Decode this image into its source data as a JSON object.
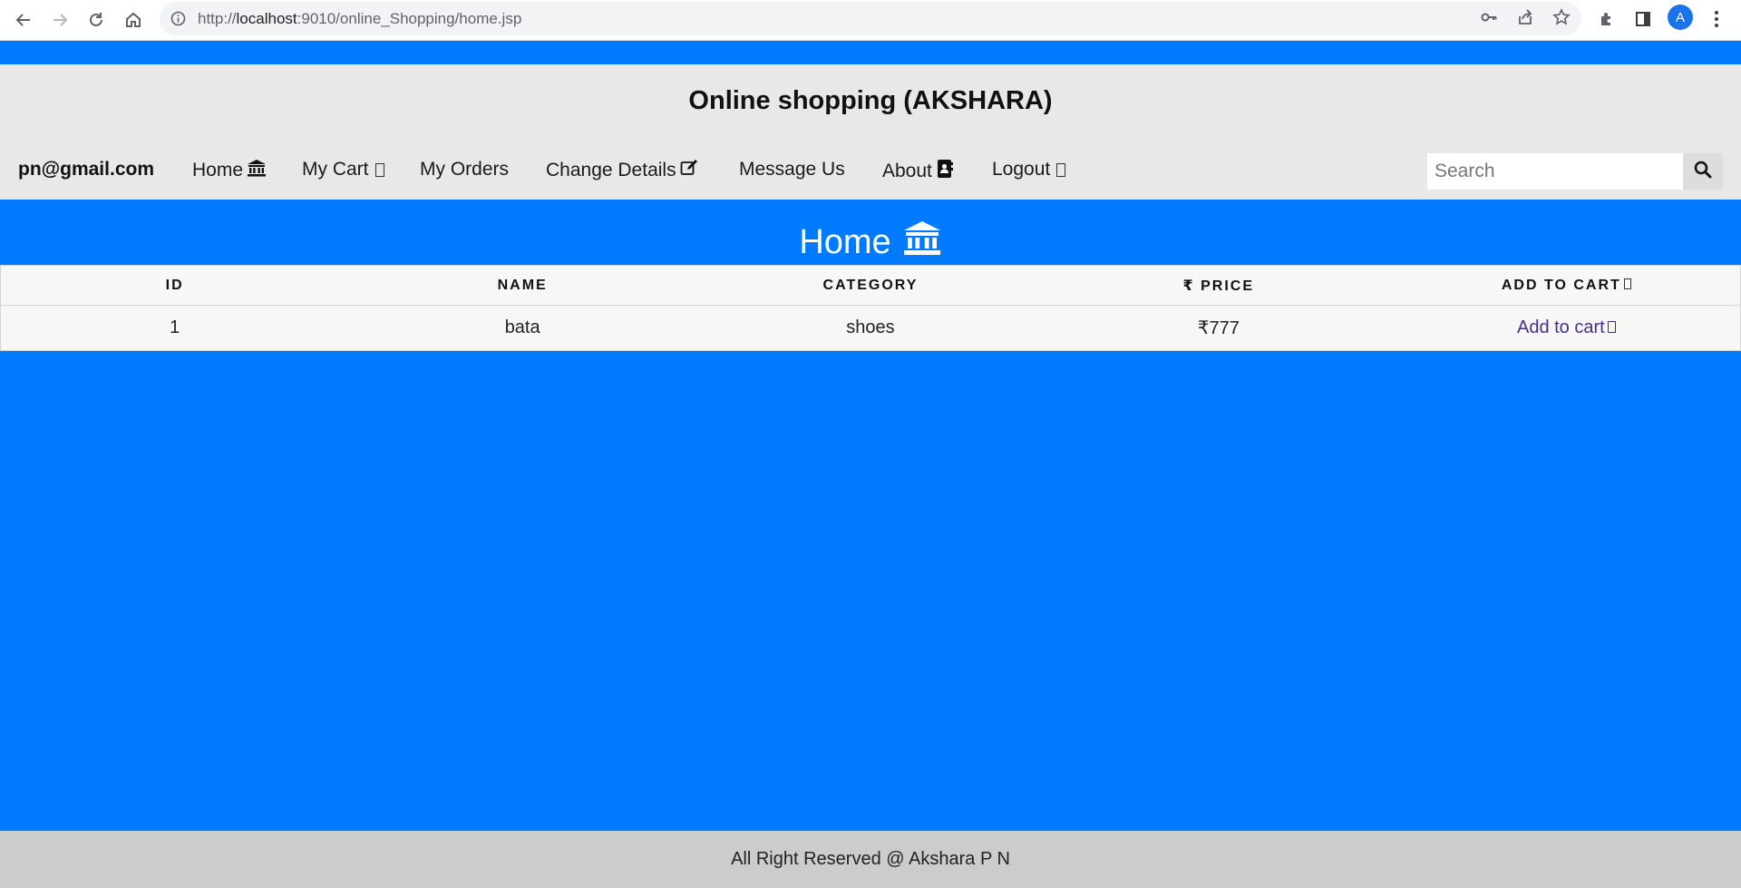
{
  "browser": {
    "url_prefix": "http://",
    "url_host": "localhost",
    "url_rest": ":9010/online_Shopping/home.jsp",
    "profile_initial": "A"
  },
  "site": {
    "title": "Online shopping (AKSHARA)"
  },
  "nav": {
    "user_email": "pn@gmail.com",
    "items": [
      {
        "label": "Home",
        "icon": "bank-icon"
      },
      {
        "label": "My Cart",
        "icon": "cart-icon"
      },
      {
        "label": "My Orders"
      },
      {
        "label": "Change Details",
        "icon": "edit-icon"
      },
      {
        "label": "Message Us"
      },
      {
        "label": "About",
        "icon": "address-book-icon"
      },
      {
        "label": "Logout",
        "icon": "sign-out-icon"
      }
    ],
    "search_placeholder": "Search"
  },
  "section": {
    "title": "Home"
  },
  "table": {
    "headers": [
      "ID",
      "NAME",
      "CATEGORY",
      "₹ PRICE",
      "ADD TO CART"
    ],
    "rows": [
      {
        "id": "1",
        "name": "bata",
        "category": "shoes",
        "price": "₹777",
        "action": "Add to cart"
      }
    ]
  },
  "footer": {
    "text": "All Right Reserved @ Akshara P N"
  },
  "colors": {
    "accent": "#007bff",
    "header_bg": "#e8e8e8",
    "footer_bg": "#cccccc",
    "link": "#4a2e86"
  }
}
